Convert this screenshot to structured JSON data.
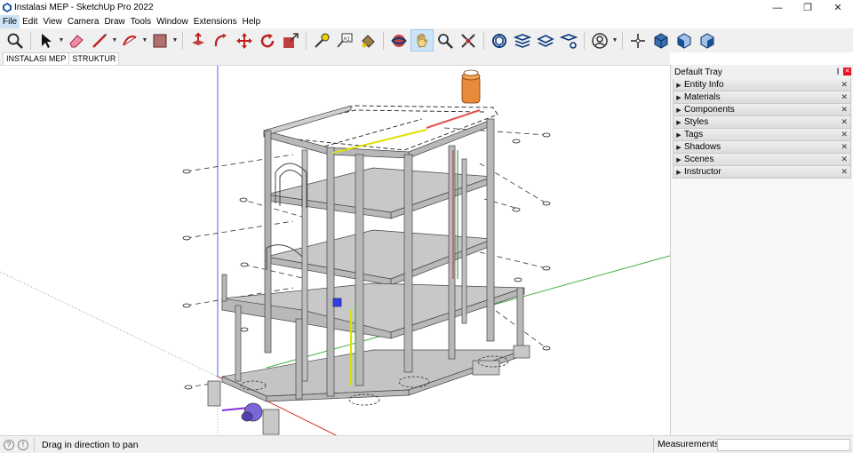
{
  "window": {
    "title": "Instalasi MEP - SketchUp Pro 2022",
    "minimize": "—",
    "restore": "❐",
    "close": "✕"
  },
  "menu": [
    "File",
    "Edit",
    "View",
    "Camera",
    "Draw",
    "Tools",
    "Window",
    "Extensions",
    "Help"
  ],
  "toolbar": {
    "tools": [
      {
        "name": "zoom-extents-icon",
        "caret": false
      },
      {
        "name": "select-icon",
        "caret": true
      },
      {
        "name": "eraser-icon",
        "caret": false
      },
      {
        "name": "line-icon",
        "caret": true
      },
      {
        "name": "arc-icon",
        "caret": true
      },
      {
        "name": "rectangle-icon",
        "caret": true
      },
      {
        "name": "push-pull-icon",
        "caret": false
      },
      {
        "name": "offset-icon",
        "caret": false
      },
      {
        "name": "move-icon",
        "caret": false
      },
      {
        "name": "rotate-icon",
        "caret": false
      },
      {
        "name": "scale-icon",
        "caret": false
      },
      {
        "name": "tape-measure-icon",
        "caret": false
      },
      {
        "name": "text-icon",
        "caret": false
      },
      {
        "name": "paint-bucket-icon",
        "caret": false
      },
      {
        "name": "orbit-icon",
        "caret": false
      },
      {
        "name": "pan-icon",
        "caret": false,
        "selected": true
      },
      {
        "name": "zoom-icon",
        "caret": false
      },
      {
        "name": "zoom-window-icon",
        "caret": false
      },
      {
        "name": "3d-warehouse-icon",
        "caret": false
      },
      {
        "name": "layers-icon",
        "caret": false
      },
      {
        "name": "extension-warehouse-icon",
        "caret": false
      },
      {
        "name": "layout-icon",
        "caret": false
      },
      {
        "name": "profile-icon",
        "caret": true
      },
      {
        "name": "axes-icon",
        "caret": false
      },
      {
        "name": "iso-view-icon",
        "caret": false
      },
      {
        "name": "front-view-icon",
        "caret": false
      },
      {
        "name": "right-view-icon",
        "caret": false
      }
    ]
  },
  "scene_tabs": [
    "INSTALASI MEP",
    "STRUKTUR"
  ],
  "tray": {
    "title": "Default Tray",
    "pin": "❙",
    "close": "✕",
    "panels": [
      "Entity Info",
      "Materials",
      "Components",
      "Styles",
      "Tags",
      "Shadows",
      "Scenes",
      "Instructor"
    ]
  },
  "status": {
    "message": "Drag in direction to pan",
    "measurements_label": "Measurements",
    "measurements_value": ""
  },
  "colors": {
    "accent_selected": "#cde4f7",
    "axis_red": "#d00000",
    "axis_green": "#00a000",
    "axis_blue": "#0000d0",
    "structure_gray": "#a0a0a0",
    "tray_close": "#e81123"
  }
}
